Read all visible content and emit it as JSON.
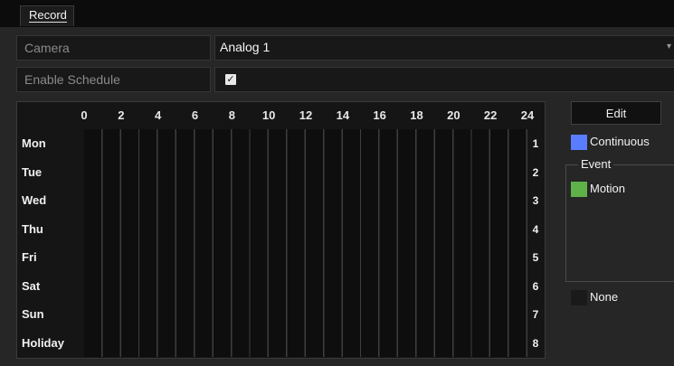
{
  "tab": {
    "label": "Record"
  },
  "camera": {
    "label": "Camera",
    "value": "Analog 1"
  },
  "schedule": {
    "label": "Enable Schedule",
    "checked": true,
    "check_glyph": "✓"
  },
  "hours": [
    "0",
    "2",
    "4",
    "6",
    "8",
    "10",
    "12",
    "14",
    "16",
    "18",
    "20",
    "22",
    "24"
  ],
  "days": [
    {
      "name": "Mon",
      "num": "1"
    },
    {
      "name": "Tue",
      "num": "2"
    },
    {
      "name": "Wed",
      "num": "3"
    },
    {
      "name": "Thu",
      "num": "4"
    },
    {
      "name": "Fri",
      "num": "5"
    },
    {
      "name": "Sat",
      "num": "6"
    },
    {
      "name": "Sun",
      "num": "7"
    },
    {
      "name": "Holiday",
      "num": "8"
    }
  ],
  "edit_button": {
    "label": "Edit"
  },
  "legend": {
    "continuous": {
      "label": "Continuous",
      "color": "#5a7dff"
    },
    "event": {
      "label": "Event"
    },
    "motion": {
      "label": "Motion",
      "color": "#5fb14a"
    },
    "none": {
      "label": "None",
      "color": "#1a1a1a"
    }
  },
  "colors": {
    "background": "#262626",
    "panel": "#181818",
    "grid": "#0e0e0e",
    "grid_line": "#3e3e3e"
  }
}
